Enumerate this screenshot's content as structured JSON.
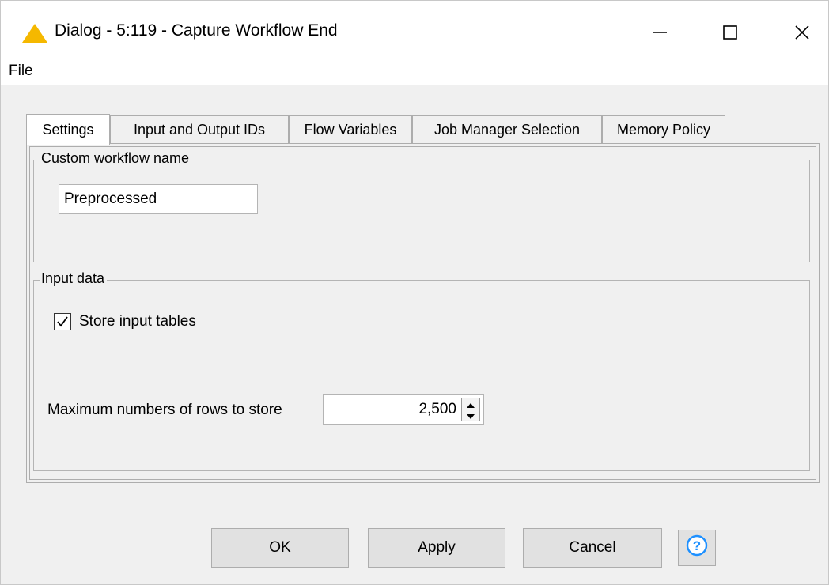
{
  "window": {
    "title": "Dialog - 5:119 - Capture Workflow End",
    "warning_icon_color": "#f5b800"
  },
  "menu": {
    "file": "File"
  },
  "tabs": [
    {
      "label": "Settings",
      "active": true
    },
    {
      "label": "Input and Output IDs",
      "active": false
    },
    {
      "label": "Flow Variables",
      "active": false
    },
    {
      "label": "Job Manager Selection",
      "active": false
    },
    {
      "label": "Memory Policy",
      "active": false
    }
  ],
  "workflow_group": {
    "legend": "Custom workflow name",
    "name_value": "Preprocessed"
  },
  "input_group": {
    "legend": "Input data",
    "store_tables_label": "Store input tables",
    "store_tables_checked": true,
    "max_rows_label": "Maximum numbers of rows to store",
    "max_rows_value": "2,500"
  },
  "buttons": {
    "ok": "OK",
    "apply": "Apply",
    "cancel": "Cancel"
  },
  "colors": {
    "help_icon": "#1e90ff"
  }
}
